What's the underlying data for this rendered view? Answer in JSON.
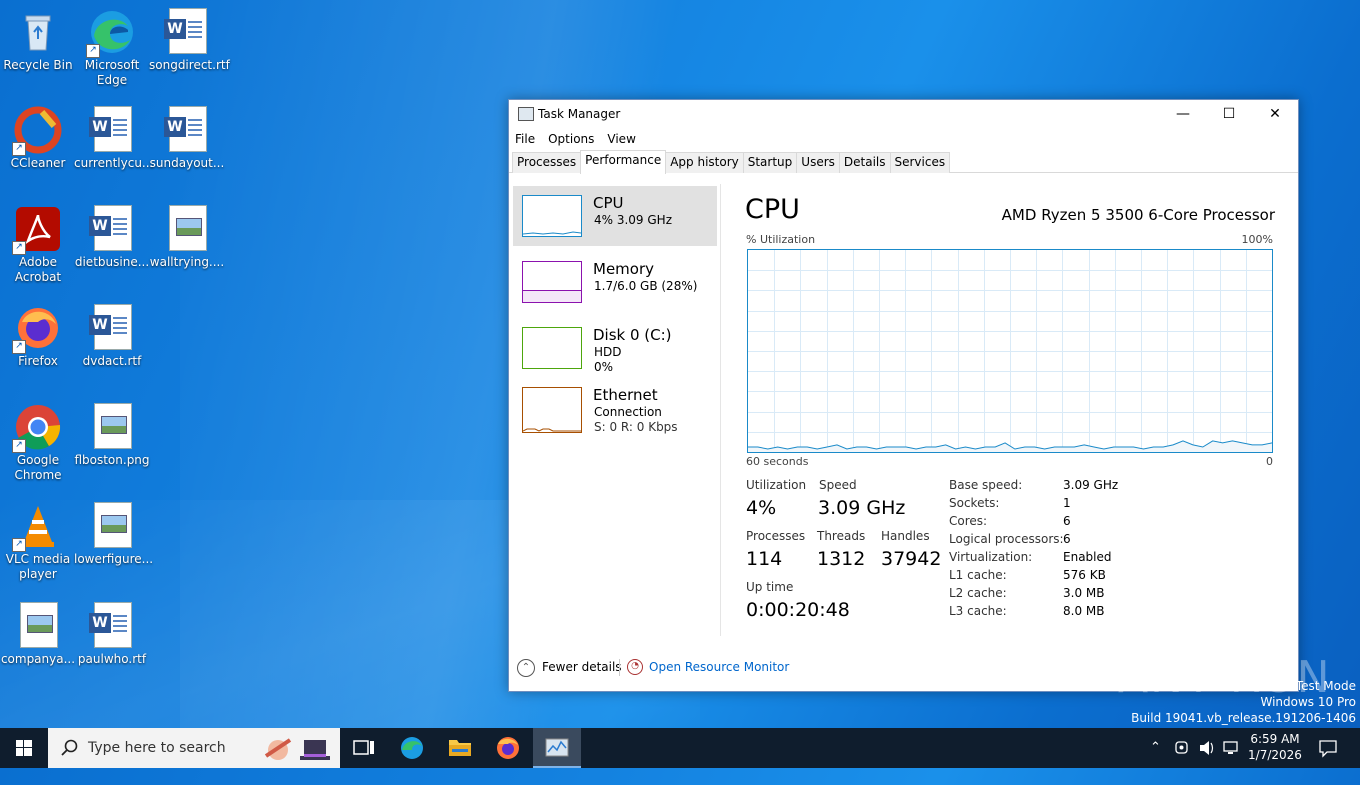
{
  "desktop": {
    "icons": [
      {
        "label": "Recycle Bin"
      },
      {
        "label": "Microsoft Edge"
      },
      {
        "label": "songdirect.rtf"
      },
      {
        "label": "CCleaner"
      },
      {
        "label": "currentlycu..."
      },
      {
        "label": "sundayout..."
      },
      {
        "label": "Adobe Acrobat"
      },
      {
        "label": "dietbusine..."
      },
      {
        "label": "walltrying...."
      },
      {
        "label": "Firefox"
      },
      {
        "label": "dvdact.rtf"
      },
      {
        "label": "Google Chrome"
      },
      {
        "label": "flboston.png"
      },
      {
        "label": "VLC media player"
      },
      {
        "label": "lowerfigure..."
      },
      {
        "label": "companya..."
      },
      {
        "label": "paulwho.rtf"
      }
    ]
  },
  "window": {
    "title": "Task Manager",
    "menu": [
      "File",
      "Options",
      "View"
    ],
    "tabs": [
      "Processes",
      "Performance",
      "App history",
      "Startup",
      "Users",
      "Details",
      "Services"
    ],
    "active_tab": "Performance"
  },
  "sidebar": [
    {
      "name": "CPU",
      "line1": "4%  3.09 GHz",
      "line2": "",
      "color": "#1a8ac9"
    },
    {
      "name": "Memory",
      "line1": "1.7/6.0 GB (28%)",
      "line2": "",
      "color": "#8b12ae"
    },
    {
      "name": "Disk 0 (C:)",
      "line1": "HDD",
      "line2": "0%",
      "color": "#4da60c"
    },
    {
      "name": "Ethernet",
      "line1": "Connection",
      "line2": "S: 0  R: 0 Kbps",
      "color": "#a74f01"
    }
  ],
  "cpu": {
    "title": "CPU",
    "model": "AMD Ryzen 5 3500 6-Core Processor",
    "graph_label": "% Utilization",
    "graph_max": "100%",
    "graph_time": "60 seconds",
    "graph_min": "0",
    "graph_series": [
      2,
      2,
      1,
      2,
      1,
      2,
      2,
      1,
      2,
      3,
      1,
      2,
      2,
      1,
      2,
      2,
      2,
      1,
      2,
      2,
      3,
      1,
      2,
      1,
      2,
      2,
      4,
      1,
      2,
      2,
      1,
      2,
      2,
      2,
      3,
      2,
      1,
      2,
      2,
      2,
      1,
      2,
      2,
      3,
      5,
      3,
      2,
      5,
      4,
      5,
      4,
      3,
      3,
      4
    ],
    "stats": {
      "utilization_label": "Utilization",
      "utilization": "4%",
      "speed_label": "Speed",
      "speed": "3.09 GHz",
      "processes_label": "Processes",
      "processes": "114",
      "threads_label": "Threads",
      "threads": "1312",
      "handles_label": "Handles",
      "handles": "37942",
      "uptime_label": "Up time",
      "uptime": "0:00:20:48"
    },
    "details": [
      {
        "k": "Base speed:",
        "v": "3.09 GHz"
      },
      {
        "k": "Sockets:",
        "v": "1"
      },
      {
        "k": "Cores:",
        "v": "6"
      },
      {
        "k": "Logical processors:",
        "v": "6"
      },
      {
        "k": "Virtualization:",
        "v": "Enabled"
      },
      {
        "k": "L1 cache:",
        "v": "576 KB"
      },
      {
        "k": "L2 cache:",
        "v": "3.0 MB"
      },
      {
        "k": "L3 cache:",
        "v": "8.0 MB"
      }
    ]
  },
  "footer": {
    "fewer": "Fewer details",
    "resmon": "Open Resource Monitor"
  },
  "watermark": {
    "line1": "Test Mode",
    "line2": "Windows 10 Pro",
    "line3": "Build 19041.vb_release.191206-1406",
    "brand": "ANY RUN"
  },
  "taskbar": {
    "search_placeholder": "Type here to search",
    "time": "6:59 AM",
    "date": "1/7/2026"
  }
}
